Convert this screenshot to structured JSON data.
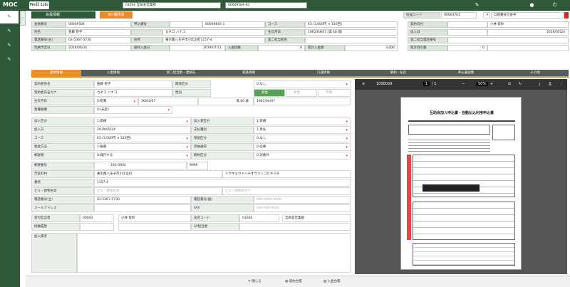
{
  "app": {
    "logo": "MOC",
    "logo2": "Well Life",
    "company_select": "01000 互助会営業部",
    "contract_search": "00009584-K3"
  },
  "section": {
    "title": "会員情報",
    "badge": "90:義務消",
    "postal_label": "住届コード",
    "postal_code": "00004761",
    "flag_label": "口座番号引会中"
  },
  "header_rows": [
    [
      [
        "会員番号",
        "00009584"
      ],
      [
        "申込番号",
        ""
      ],
      [
        "",
        "00009845-1"
      ],
      [
        "コース",
        "K3 (3,000円 × 120回)"
      ],
      [
        "契約日付",
        ""
      ],
      [
        "小林 智紗",
        ""
      ]
    ],
    [
      [
        "氏名",
        "亜藤 花子"
      ],
      [
        "カナ",
        "カネコ ハナコ"
      ],
      [
        "生年月日",
        "1961/04/07 (満 60 歳)"
      ],
      [
        "加入日",
        "2019/05/24"
      ]
    ],
    [
      [
        "電話番号(主)",
        "03-5367-5730"
      ],
      [
        "住所",
        "東京都八王子市小比企町1157-4"
      ],
      [
        "第二担当者名",
        ""
      ],
      [
        "第二担当電話番号",
        ""
      ]
    ],
    [
      [
        "完納予定日",
        "2029/06/30"
      ],
      [
        "最終入金日",
        "2019/07/11"
      ],
      [
        "入金回数",
        "0"
      ],
      [
        "累計入金額",
        "3,000"
      ],
      [
        "累計割引額",
        "0"
      ]
    ]
  ],
  "tabs": [
    "基本情報",
    "入金情報",
    "第二担当者・連絡先",
    "家族情報",
    "口座情報",
    "解約・払戻",
    "申込書画像",
    "その他"
  ],
  "form": {
    "contractor_name_lbl": "契約者氏名",
    "contractor_name": "亜藤 花子",
    "contractor_kana_lbl": "契約者氏名カナ",
    "contractor_kana": "カネコ ハナコ",
    "birth_lbl": "生年月日",
    "era": "S:昭和",
    "birth_jp": "36/04/07",
    "age": "満 60 歳",
    "birth": "1961/04/07",
    "job_lbl": "業種職種",
    "job": "0:(未定)",
    "related_lbl": "関係区分",
    "related": "0:なし",
    "gender_lbl": "性別",
    "gender_opts": [
      "男性",
      "女性",
      "不明"
    ],
    "join_type_lbl": "加入区分",
    "join_type": "1:新規",
    "join_date_lbl": "加入日",
    "join_date": "2019/05/24",
    "course_lbl": "コース",
    "course": "K3 (3,000円 × 120回)",
    "pay_method_lbl": "集金方法",
    "pay_method": "1:振替",
    "mail_lbl": "郵送物",
    "mail": "0:発行する",
    "join_reason_lbl": "加入者区分",
    "join_reason": "1:新規",
    "pay_type_lbl": "支払種別",
    "pay_type": "1:月払",
    "insurance_lbl": "保留区分",
    "insurance": "0:なし",
    "notice_lbl": "完納通知",
    "notice": "0:必要",
    "grade_lbl": "解約区分",
    "grade": "0:対象外",
    "zip_lbl": "郵便番号",
    "zip": "193-0934",
    "zip_extra": "9999",
    "pref_lbl": "市区町村",
    "pref": "東京都八王子市小比企町",
    "pref_kana": "トウキョウトハチオウジシコヒキマチ",
    "addr_lbl": "番地",
    "addr": "1157-4",
    "bldg_lbl": "ビル・建物名等",
    "bldg_ph": "ビル・建物名等",
    "bldg_kana_ph": "ビル・建物名カナ",
    "tel_lbl": "電話番号(主)",
    "tel": "03-5367-5730",
    "tel2_lbl": "電話番号(副)",
    "tel2_ph": "000-0000-0000",
    "mail_addr_lbl": "メールアドレス",
    "fax_lbl": "FAX",
    "fax_ph": "000-000-0000",
    "agent_lbl": "受付担当者",
    "agent_code": "00003",
    "agent_name": "小林 智紗",
    "branch_lbl": "支店コード",
    "branch_code": "01000",
    "branch_name": "互助会営業部",
    "visit_lbl": "接触履歴",
    "ap_lbl": "AP担当者",
    "memo_lbl": "加入備考"
  },
  "pdf": {
    "filename": "1000039",
    "page": "1",
    "pages": "/ 1",
    "zoom": "50%",
    "form_title": "互助会加入申込書・自動払込利用申込書"
  },
  "footer": {
    "close": "閉じる",
    "contract": "契約台帳",
    "deposit": "入金台帳"
  }
}
